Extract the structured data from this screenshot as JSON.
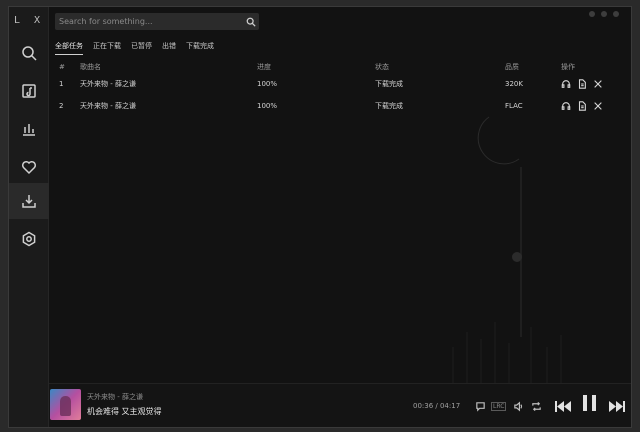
{
  "app": {
    "logo": "L X"
  },
  "search": {
    "placeholder": "Search for something..."
  },
  "tabs": [
    {
      "label": "全部任务",
      "active": true
    },
    {
      "label": "正在下载",
      "active": false
    },
    {
      "label": "已暂停",
      "active": false
    },
    {
      "label": "出错",
      "active": false
    },
    {
      "label": "下载完成",
      "active": false
    }
  ],
  "table": {
    "headers": {
      "index": "#",
      "name": "歌曲名",
      "progress": "进度",
      "status": "状态",
      "quality": "品质",
      "ops": "操作"
    },
    "rows": [
      {
        "index": "1",
        "name": "天外来物 - 薛之谦",
        "progress": "100%",
        "status": "下载完成",
        "quality": "320K"
      },
      {
        "index": "2",
        "name": "天外来物 - 薛之谦",
        "progress": "100%",
        "status": "下载完成",
        "quality": "FLAC"
      }
    ]
  },
  "player": {
    "song": "天外来物 - 薛之谦",
    "lyric": "机会难得 又主观觉得",
    "time": "00:36 / 04:17",
    "lrc_label": "LRC"
  }
}
